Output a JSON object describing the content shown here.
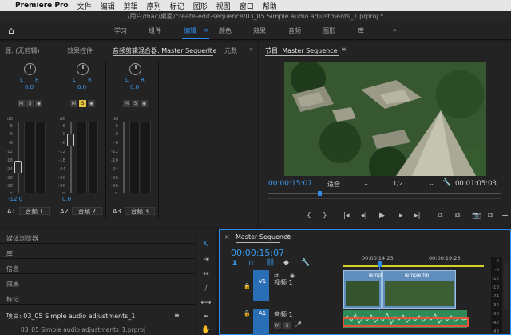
{
  "menubar": {
    "apple": "",
    "app": "Premiere Pro",
    "items": [
      "文件",
      "编辑",
      "剪辑",
      "序列",
      "标记",
      "图形",
      "视图",
      "窗口",
      "帮助"
    ]
  },
  "window": {
    "path": "/用户/mac/桌面/create-edit-sequence/03_05 Simple audio adjustments_1.prproj *"
  },
  "workspace": {
    "home": "⌂",
    "tabs": [
      "学习",
      "组件",
      "编辑",
      "颜色",
      "效果",
      "音频",
      "图形",
      "库"
    ],
    "active": 2,
    "menu": "≡",
    "more": "»"
  },
  "source_panel": {
    "tabs": [
      "源: (无剪辑)",
      "效果控件",
      "音频剪辑混合器: Master Sequence",
      "元数"
    ],
    "menu": "≡",
    "more": "»",
    "channels": [
      {
        "pan_l": "L",
        "pan_r": "R",
        "value": "0.0",
        "m": "M",
        "s": "S",
        "r": "◉",
        "bottom_value": "-12.0",
        "track": "A1",
        "name": "音频 1"
      },
      {
        "pan_l": "L",
        "pan_r": "R",
        "value": "0.0",
        "m": "M",
        "s": "S",
        "r": "◉",
        "bottom_value": "0.0",
        "track": "A2",
        "name": "音频 2"
      },
      {
        "pan_l": "L",
        "pan_r": "R",
        "value": "0.0",
        "m": "M",
        "s": "S",
        "r": "◉",
        "bottom_value": "0.0",
        "track": "A3",
        "name": "音频 3"
      }
    ],
    "scale": [
      "dB",
      "6",
      "0",
      "-6",
      "-12",
      "-18",
      "-24",
      "-30",
      "-36",
      "-∞"
    ]
  },
  "program_panel": {
    "title": "节目: Master Sequence",
    "menu": "≡",
    "timecode": "00:00:15:07",
    "fit": "适合",
    "resolution": "1/2",
    "duration": "00:01:05:03",
    "wrench": "🔧",
    "controls": [
      "{",
      "}",
      "|◂",
      "◂|",
      "▶",
      "|▸",
      "▸|",
      "⧉",
      "⧉",
      "📷",
      "⧉",
      "+"
    ],
    "colors": {
      "playhead": "#2d8ceb",
      "timecode": "#3a9bf0"
    }
  },
  "left_panel": {
    "items": [
      "媒体浏览器",
      "库",
      "信息",
      "效果",
      "标记"
    ],
    "project_title": "项目: 03_05 Simple audio adjustments_1",
    "project_menu": "≡",
    "project_file": "03_05 Simple audio adjustments_1.prproj"
  },
  "tools": [
    "↖",
    "⇥",
    "↔",
    "⧸",
    "⟷",
    "✒",
    "✋"
  ],
  "timeline": {
    "close": "×",
    "title": "Master Sequence",
    "menu": "≡",
    "timecode": "00:00:15:07",
    "ticks": [
      "00:00:14:23",
      "00:00:19:23"
    ],
    "tracks": [
      {
        "id": "V1",
        "name": "视频 1",
        "lock": "🔒",
        "eye": "◉",
        "sync": "⇄"
      },
      {
        "id": "A1",
        "name": "音频 1",
        "lock": "🔒",
        "m": "M",
        "s": "S",
        "mic": "🎤"
      }
    ],
    "clips": [
      "Templ",
      "Temple fro"
    ],
    "meter_scale": [
      "0",
      "-6",
      "-12",
      "-18",
      "-24",
      "-30",
      "-36",
      "-42",
      "-48"
    ],
    "icons": {
      "snap": "⧗",
      "magnet": "∩",
      "linked": "⛓",
      "marker": "◆",
      "wrench": "🔧"
    },
    "colors": {
      "track_blue": "#2a6fb6",
      "highlight": "#e5533a",
      "audio_green": "#2e8b57"
    }
  }
}
